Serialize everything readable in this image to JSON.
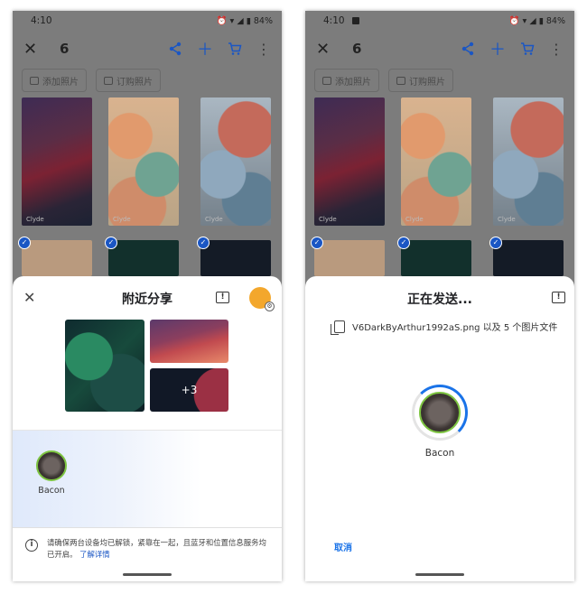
{
  "statusbar": {
    "time": "4:10",
    "battery": "84%"
  },
  "gallery": {
    "selected_count": "6",
    "chips": [
      {
        "label": "添加照片"
      },
      {
        "label": "订购照片"
      }
    ],
    "thumb_label": "Clyde"
  },
  "left_sheet": {
    "title": "附近分享",
    "more_count": "+3",
    "device_name": "Bacon",
    "info_text": "请确保两台设备均已解锁，紧靠在一起，且蓝牙和位置信息服务均已开启。",
    "info_link": "了解详情"
  },
  "right_sheet": {
    "title": "正在发送...",
    "file_text": "V6DarkByArthur1992aS.png 以及 5 个图片文件",
    "device_name": "Bacon",
    "cancel_label": "取消",
    "progress": 0.25
  },
  "icons": {
    "close": "close-icon",
    "share": "share-icon",
    "add": "plus-icon",
    "cart": "cart-icon",
    "more": "more-vert-icon",
    "feedback": "feedback-icon",
    "info": "info-icon",
    "file": "file-icon"
  },
  "colors": {
    "accent": "#1a56c4",
    "link": "#1a73e8",
    "device_ring": "#7dc441"
  }
}
